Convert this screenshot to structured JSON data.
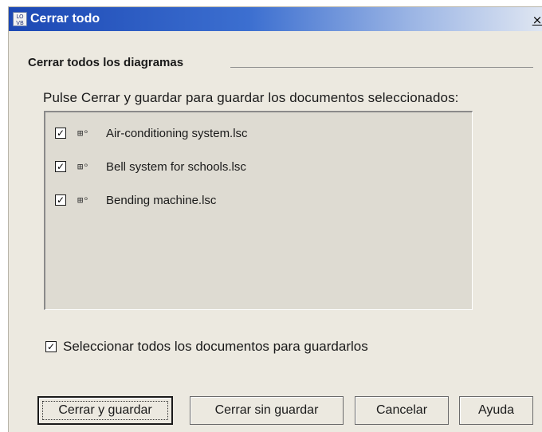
{
  "window": {
    "title": "Cerrar todo",
    "app_icon_text": "LOGO VB",
    "close_glyph": "×"
  },
  "group": {
    "title": "Cerrar todos los diagramas",
    "instruction": "Pulse Cerrar y guardar para guardar los documentos seleccionados:"
  },
  "documents": [
    {
      "name": "Air-conditioning system.lsc",
      "checked": true
    },
    {
      "name": "Bell system for schools.lsc",
      "checked": true
    },
    {
      "name": "Bending machine.lsc",
      "checked": true
    }
  ],
  "select_all": {
    "label": "Seleccionar todos los documentos para guardarlos",
    "checked": true
  },
  "buttons": {
    "close_save": "Cerrar y guardar",
    "close_no_save": "Cerrar sin guardar",
    "cancel": "Cancelar",
    "help": "Ayuda"
  },
  "icons": {
    "app": "logo-vb-icon",
    "diagram": "diagram-file-icon",
    "check": "checkmark-icon"
  }
}
